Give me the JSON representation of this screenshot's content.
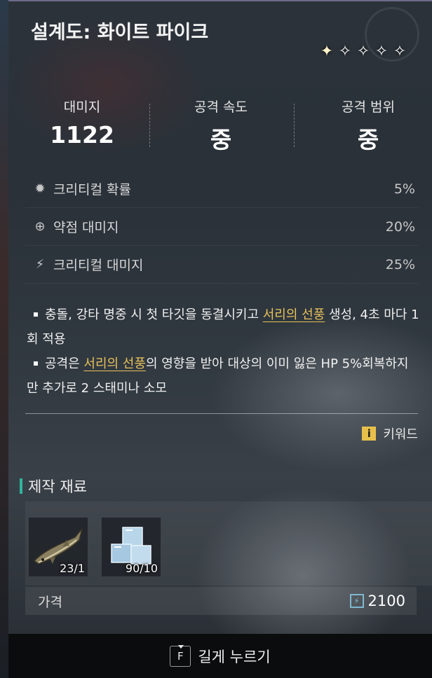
{
  "title": "설계도: 화이트 파이크",
  "rarity": {
    "stars_total": 5,
    "stars_lit": 1
  },
  "stats": [
    {
      "label": "대미지",
      "value": "1122"
    },
    {
      "label": "공격 속도",
      "value": "중"
    },
    {
      "label": "공격 범위",
      "value": "중"
    }
  ],
  "sub_stats": [
    {
      "icon": "burst-icon",
      "label": "크리티컬 확률",
      "value": "5%"
    },
    {
      "icon": "weakpoint-icon",
      "label": "약점 대미지",
      "value": "20%"
    },
    {
      "icon": "claw-icon",
      "label": "크리티컬 대미지",
      "value": "25%"
    }
  ],
  "description": {
    "line1_a": "충돌, 강타 명중 시 첫 타깃을 동결시키고 ",
    "line1_kw": "서리의 선풍",
    "line1_b": " 생성, 4초 마다 1회 적용",
    "line2_a": "공격은 ",
    "line2_kw": "서리의 선풍",
    "line2_b": "의 영향을 받아 대상의 이미 잃은 HP 5%회복하지만 추가로 2 스태미나 소모"
  },
  "keyword_label": "키워드",
  "materials_title": "제작 재료",
  "materials": [
    {
      "icon": "fish-icon",
      "count": "23/1"
    },
    {
      "icon": "ice-cube-icon",
      "count": "90/10"
    }
  ],
  "price": {
    "label": "가격",
    "value": "2100"
  },
  "footer": {
    "key": "F",
    "action": "길게 누르기"
  },
  "colors": {
    "keyword": "#e8c25a",
    "accent": "#2fb59d",
    "info": "#e7c04c"
  }
}
